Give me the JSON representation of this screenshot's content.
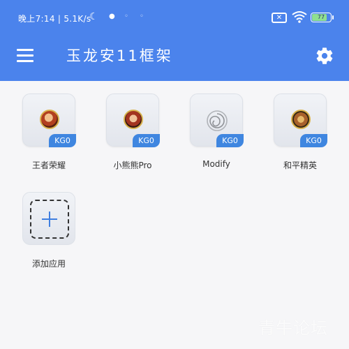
{
  "status_bar": {
    "text": "晚上7:14 | 5.1K/s",
    "icons": [
      "moon-icon",
      "notification-dot-icon",
      "sim-x-icon",
      "wifi-icon",
      "battery-icon"
    ],
    "battery_percent": "77",
    "battery_level": 0.77
  },
  "header": {
    "title": "玉龙安11框架",
    "menu_icon": "hamburger-menu-icon",
    "settings_icon": "gear-icon",
    "accent_color": "#4b83ec"
  },
  "apps": [
    {
      "label": "王者荣耀",
      "badge": "KG0",
      "icon": "game-hero-icon"
    },
    {
      "label": "小熊熊Pro",
      "badge": "KG0",
      "icon": "game-hero-icon"
    },
    {
      "label": "Modify",
      "badge": "KG0",
      "icon": "swirl-icon"
    },
    {
      "label": "和平精英",
      "badge": "KG0",
      "icon": "game-hero-icon"
    }
  ],
  "add_app": {
    "label": "添加应用",
    "icon": "plus-icon"
  },
  "watermark": "青牛论坛"
}
